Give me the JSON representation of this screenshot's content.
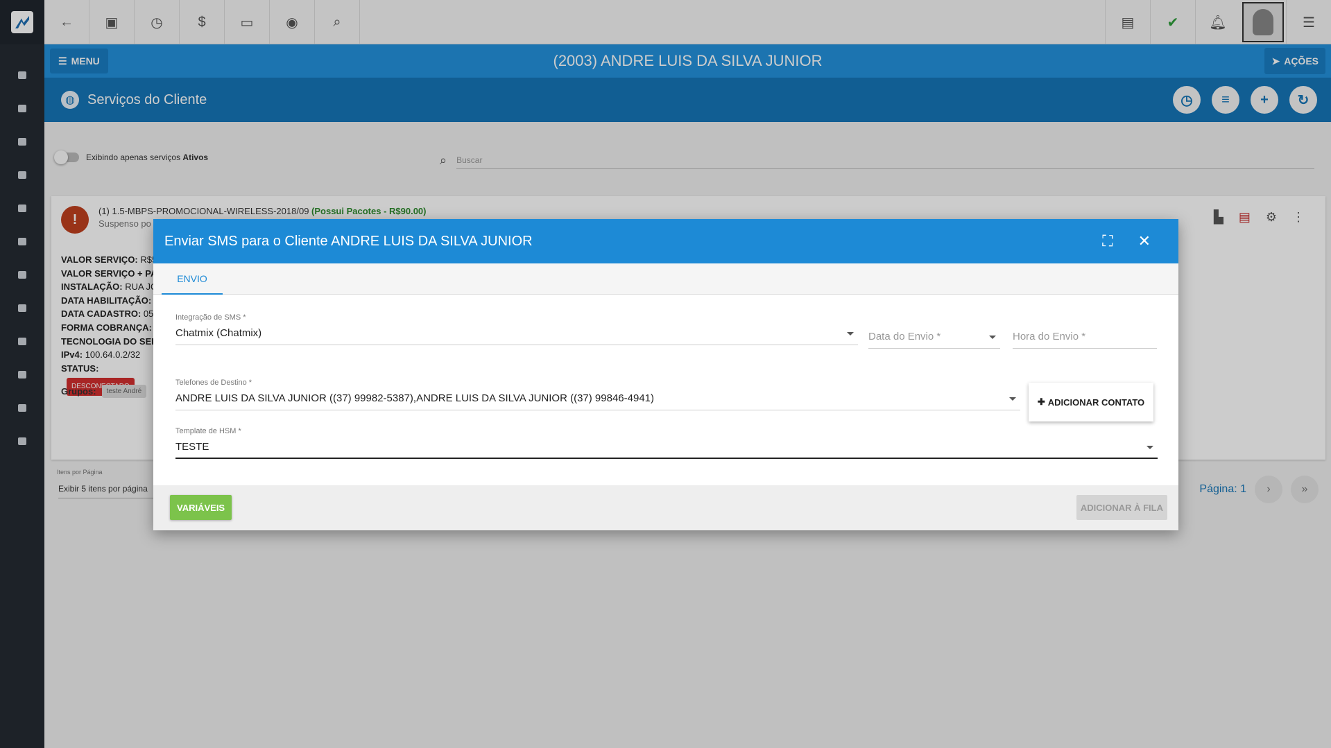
{
  "topbar": {
    "icons": [
      "back-icon",
      "person-icon",
      "schedule-icon",
      "dollar-icon",
      "terminal-icon",
      "eye-icon",
      "search-icon"
    ],
    "right_icons": [
      "pdf-icon",
      "check-icon",
      "bell-icon",
      "avatar",
      "list-icon"
    ]
  },
  "header": {
    "menu_label": "MENU",
    "client_title": "(2003) ANDRE LUIS DA SILVA JUNIOR",
    "acoes_label": "AÇÕES"
  },
  "section": {
    "title": "Serviços do Cliente"
  },
  "filters": {
    "toggle_text": "Exibindo apenas serviços ",
    "toggle_bold": "Ativos",
    "search_placeholder": "Buscar"
  },
  "service": {
    "name": "(1) 1.5-MBPS-PROMOCIONAL-WIRELESS-2018/09 ",
    "packages": "(Possui Pacotes - R$90.00)",
    "sub": "Suspenso po",
    "info": [
      {
        "label": "VALOR SERVIÇO:",
        "value": " R$5"
      },
      {
        "label": "VALOR SERVIÇO + PA",
        "value": ""
      },
      {
        "label": "INSTALAÇÃO:",
        "value": " RUA JO"
      },
      {
        "label": "DATA HABILITAÇÃO:",
        "value": ""
      },
      {
        "label": "DATA CADASTRO:",
        "value": " 05"
      },
      {
        "label": "FORMA COBRANÇA:",
        "value": ""
      },
      {
        "label": "TECNOLOGIA DO SER",
        "value": ""
      },
      {
        "label": "IPv4:",
        "value": " 100.64.0.2/32"
      },
      {
        "label": "STATUS:",
        "value": ""
      }
    ],
    "status_badge": "DESCONECTADO",
    "groups_label": "Grupos:",
    "group_chip": "teste André"
  },
  "pager": {
    "per_page_label": "Itens por Página",
    "per_page_value": "Exibir 5 itens por página",
    "page_label": "Página: 1"
  },
  "modal": {
    "title": "Enviar SMS para o Cliente ANDRE LUIS DA SILVA JUNIOR",
    "tab": "ENVIO",
    "integracao_label": "Integração de SMS *",
    "integracao_value": "Chatmix (Chatmix)",
    "data_envio_placeholder": "Data do Envio *",
    "hora_envio_placeholder": "Hora do Envio *",
    "telefones_label": "Telefones de Destino *",
    "telefones_value": "ANDRE LUIS DA SILVA JUNIOR ((37) 99982-5387),ANDRE LUIS DA SILVA JUNIOR ((37) 99846-4941)",
    "add_contact_label": "ADICIONAR CONTATO",
    "template_label": "Template de HSM *",
    "template_value": "TESTE",
    "variaveis_label": "VARIÁVEIS",
    "fila_label": "ADICIONAR À FILA"
  },
  "colors": {
    "header_blue": "#2492dd",
    "section_blue": "#1676b8",
    "modal_blue": "#1d8ad6",
    "status_red": "#d32f2f",
    "green": "#7cc34b"
  }
}
